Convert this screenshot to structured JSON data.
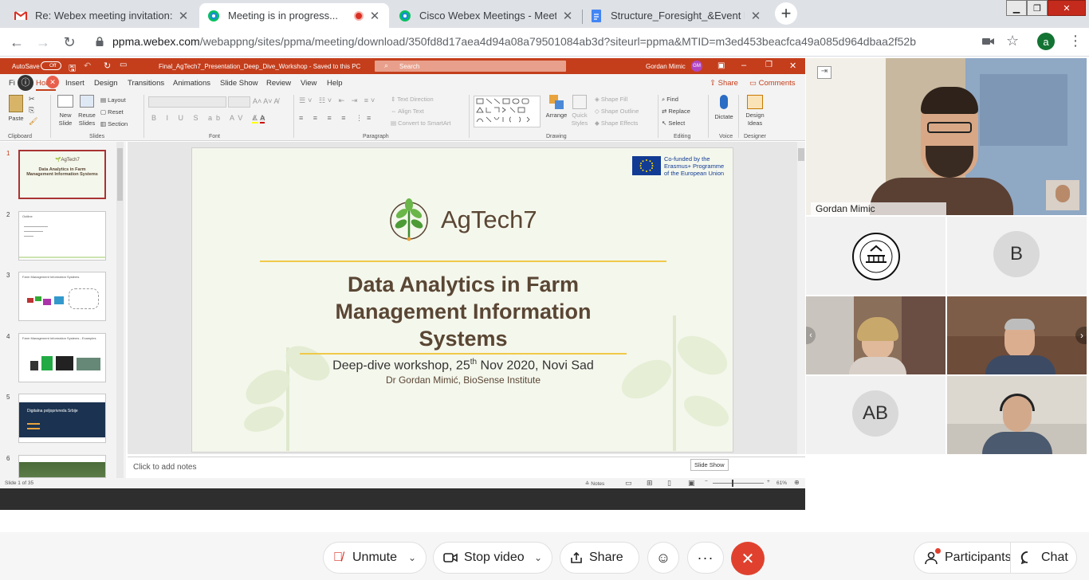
{
  "browser": {
    "tabs": [
      {
        "title": "Re: Webex meeting invitation: Ag",
        "favicon": "gmail-icon"
      },
      {
        "title": "Meeting is in progress...",
        "favicon": "webex-icon"
      },
      {
        "title": "Cisco Webex Meetings - Meeting",
        "favicon": "webex-icon"
      },
      {
        "title": "Structure_Foresight_&Event Evalu",
        "favicon": "docs-icon"
      }
    ],
    "url_host": "ppma.webex.com",
    "url_path": "/webappng/sites/ppma/meeting/download/350fd8d17aea4d94a08a79501084ab3d?siteurl=ppma&MTID=m3ed453beacfca49a085d964dbaa2f52b",
    "profile_initial": "a"
  },
  "powerpoint": {
    "autosave_label": "AutoSave",
    "autosave_state": "Off",
    "file_title": "Final_AgTech7_Presentation_Deep_Dive_Workshop  -  Saved to this PC",
    "search_placeholder": "Search",
    "user_name": "Gordan Mimic",
    "user_initials": "GM",
    "ribbon_tabs": [
      "Fi",
      "Home",
      "Insert",
      "Design",
      "Transitions",
      "Animations",
      "Slide Show",
      "Review",
      "View",
      "Help"
    ],
    "share_label": "Share",
    "comments_label": "Comments",
    "ribbon": {
      "paste": "Paste",
      "new_slide": "New Slide",
      "reuse_slides": "Reuse Slides",
      "layout": "Layout",
      "reset": "Reset",
      "section": "Section",
      "text_direction": "Text Direction",
      "align_text": "Align Text",
      "convert_smartart": "Convert to SmartArt",
      "arrange": "Arrange",
      "quick_styles": "Quick Styles",
      "shape_fill": "Shape Fill",
      "shape_outline": "Shape Outline",
      "shape_effects": "Shape Effects",
      "find": "Find",
      "replace": "Replace",
      "select": "Select",
      "dictate": "Dictate",
      "design_ideas": "Design Ideas",
      "group_labels": [
        "Clipboard",
        "Slides",
        "Font",
        "Paragraph",
        "Drawing",
        "Editing",
        "Voice",
        "Designer"
      ]
    },
    "thumbnails": [
      {
        "num": "1",
        "title": "Data Analytics in Farm Management Information Systems"
      },
      {
        "num": "2",
        "title": "Outline"
      },
      {
        "num": "3",
        "title": "Farm Management Information Systems"
      },
      {
        "num": "4",
        "title": "Farm Management Information Systems - Examples"
      },
      {
        "num": "5",
        "title": "Digitalna poljoprivreda Srbije"
      },
      {
        "num": "6",
        "title": ""
      }
    ],
    "slide": {
      "cofunded_line1": "Co-funded by the",
      "cofunded_line2": "Erasmus+ Programme",
      "cofunded_line3": "of the European Union",
      "logo_text": "AgTech7",
      "title_line1": "Data Analytics in Farm",
      "title_line2": "Management Information",
      "title_line3": "Systems",
      "subtitle_pre": "Deep-dive workshop, 25",
      "subtitle_sup": "th",
      "subtitle_post": " Nov 2020, Novi Sad",
      "author": "Dr Gordan Mimić, BioSense Institute"
    },
    "notes_placeholder": "Click to add notes",
    "status_slide": "Slide 1 of 35",
    "status_notes": "Notes",
    "tooltip": "Slide Show",
    "zoom": "61%"
  },
  "participants": [
    {
      "name": "Gordan Mimic",
      "type": "video"
    },
    {
      "name": "",
      "type": "logo"
    },
    {
      "name": "",
      "initials": "B",
      "type": "avatar"
    },
    {
      "name": "",
      "type": "video"
    },
    {
      "name": "",
      "type": "video"
    },
    {
      "name": "",
      "initials": "AB",
      "type": "avatar"
    },
    {
      "name": "",
      "type": "video"
    }
  ],
  "controls": {
    "unmute": "Unmute",
    "stop_video": "Stop video",
    "share": "Share",
    "participants": "Participants",
    "chat": "Chat"
  }
}
